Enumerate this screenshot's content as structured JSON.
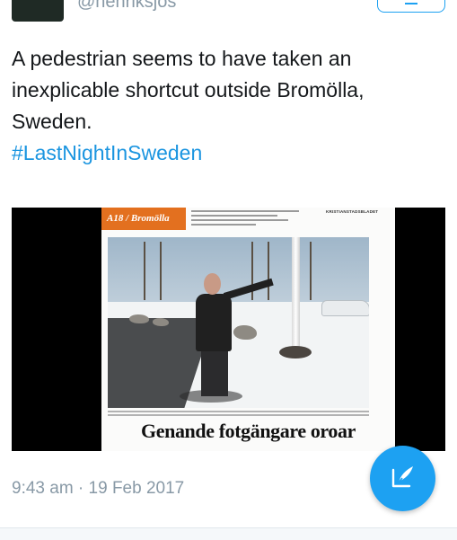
{
  "header": {
    "handle": "@henriksjos",
    "avatar_icon": "user-avatar"
  },
  "tweet": {
    "lines": [
      "A pedestrian seems to have taken an",
      "inexplicable shortcut outside Bromölla,",
      "Sweden."
    ],
    "hashtag": "#LastNightInSweden",
    "timestamp": "9:43 am · 19 Feb 2017"
  },
  "media": {
    "section_label": "A18 / Bromölla",
    "headline": "Genande fotgängare oroar",
    "masthead": "KRISTIANSTADSBLADET"
  },
  "fab": {
    "icon": "compose-tweet-icon"
  },
  "colors": {
    "accent": "#1da1f2",
    "hashtag": "#1b95e0",
    "muted": "#8899a6",
    "section_tag": "#e3701f"
  }
}
